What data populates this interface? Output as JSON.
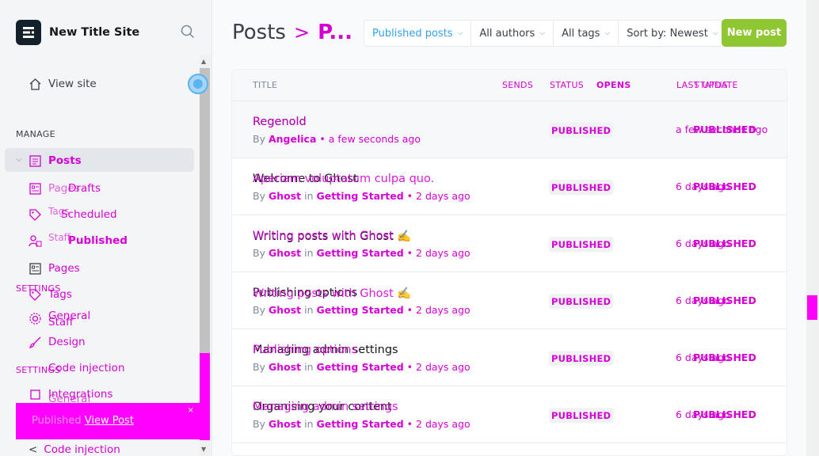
{
  "site": {
    "title": "New Title Site"
  },
  "sidebar": {
    "view_site": "View site",
    "manage_label": "MANAGE",
    "settings_label": "SETTINGS",
    "posts": "Posts",
    "drafts": "Drafts",
    "scheduled": "Scheduled",
    "published": "Published",
    "pages": "Pages",
    "pages_ghost": "Pages",
    "tags": "Tags",
    "tags_ghost": "Tags",
    "staff": "Staff",
    "staff_ghost": "Staff",
    "settings_ghost": "SETTINGS",
    "general": "General",
    "general_ghost": "General",
    "design": "Design",
    "code_injection": "Code injection",
    "integrations": "Integrations",
    "code_injection_2": "Code injection"
  },
  "toast": {
    "text": "Published",
    "link": "View Post",
    "close": "×"
  },
  "header": {
    "breadcrumb_root": "Posts",
    "breadcrumb_sep": ">",
    "breadcrumb_current": "P..."
  },
  "filters": {
    "type": "Published posts",
    "authors": "All authors",
    "tags": "All tags",
    "sort": "Sort by: Newest"
  },
  "new_post": "New post",
  "table": {
    "headers": {
      "title": "TITLE",
      "sends": "SENDS",
      "status": "STATUS",
      "opens": "OPENS",
      "last_update": "LAST UPDATE",
      "overlap": "STATUS"
    },
    "rows": [
      {
        "title": "Regenold",
        "overlay": "Regenold",
        "by": "By",
        "author": "Angelica",
        "tag_prefix": "",
        "tag": "",
        "time": "a few seconds ago",
        "status": "PUBLISHED",
        "date": "a few seconds ago",
        "date_over": "PUBLISHED"
      },
      {
        "title": "Welcome to Ghost",
        "overlay": "Aperiam voluptatum culpa quo.",
        "by": "By",
        "author": "Ghost",
        "tag_prefix": "in",
        "tag": "Getting Started",
        "time": "2 days ago",
        "status": "PUBLISHED",
        "date": "6 days ago",
        "date_over": "PUBLISHED"
      },
      {
        "title": "Writing posts with Ghost ✍️",
        "overlay": "Writing posts with Ghost",
        "by": "By",
        "author": "Ghost",
        "tag_prefix": "in",
        "tag": "Getting Started",
        "time": "2 days ago",
        "status": "PUBLISHED",
        "date": "6 days ago",
        "date_over": "PUBLISHED"
      },
      {
        "title": "Publishing options",
        "overlay": "Writing posts with Ghost ✍️",
        "by": "By",
        "author": "Ghost",
        "tag_prefix": "in",
        "tag": "Getting Started",
        "time": "2 days ago",
        "status": "PUBLISHED",
        "date": "6 days ago",
        "date_over": "PUBLISHED"
      },
      {
        "title": "Managing admin settings",
        "overlay": "Publishing options",
        "by": "By",
        "author": "Ghost",
        "tag_prefix": "in",
        "tag": "Getting Started",
        "time": "2 days ago",
        "status": "PUBLISHED",
        "date": "6 days ago",
        "date_over": "PUBLISHED"
      },
      {
        "title": "Organising your content",
        "overlay": "Managing admin settings",
        "by": "By",
        "author": "Ghost",
        "tag_prefix": "in",
        "tag": "Getting Started",
        "time": "2 days ago",
        "status": "PUBLISHED",
        "date": "6 days ago",
        "date_over": "PUBLISHED"
      }
    ]
  }
}
